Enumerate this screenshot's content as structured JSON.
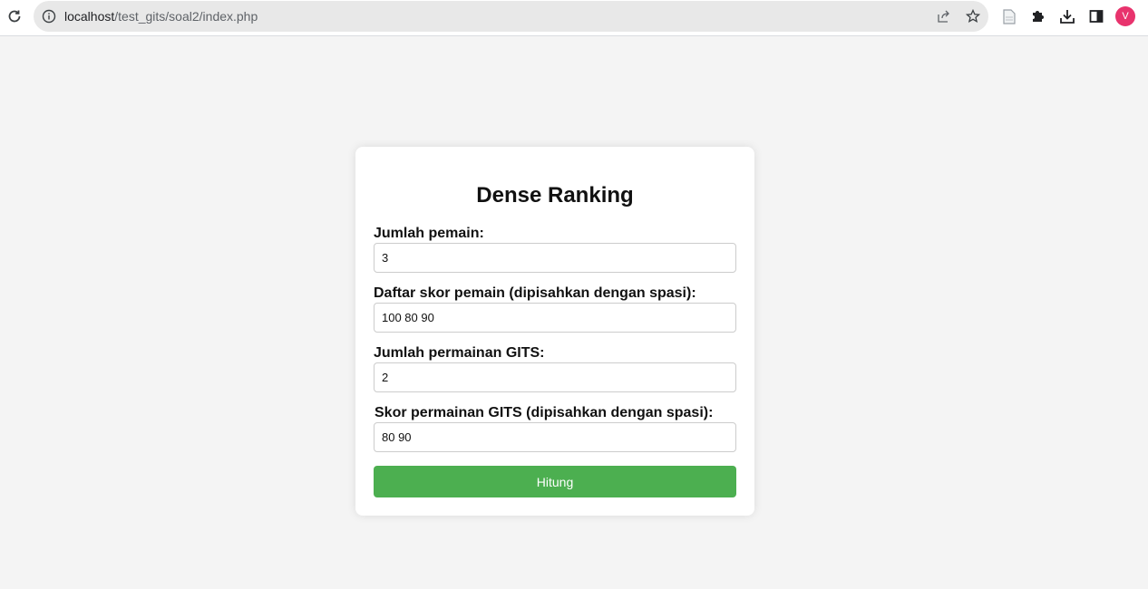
{
  "browser": {
    "url_host": "localhost",
    "url_path": "/test_gits/soal2/index.php",
    "avatar_letter": "V",
    "avatar_color": "#e8336d",
    "icons": [
      "reload-icon",
      "info-icon",
      "share-icon",
      "star-icon",
      "file-icon",
      "puzzle-icon",
      "download-icon",
      "side-panel-icon"
    ]
  },
  "form": {
    "title": "Dense Ranking",
    "fields": [
      {
        "label": "Jumlah pemain:",
        "value": "3"
      },
      {
        "label": "Daftar skor pemain (dipisahkan dengan spasi):",
        "value": "100 80 90"
      },
      {
        "label": "Jumlah permainan GITS:",
        "value": "2"
      },
      {
        "label": "Skor permainan GITS (dipisahkan dengan spasi):",
        "value": "80 90"
      }
    ],
    "submit_label": "Hitung",
    "submit_color": "#4caf50"
  }
}
